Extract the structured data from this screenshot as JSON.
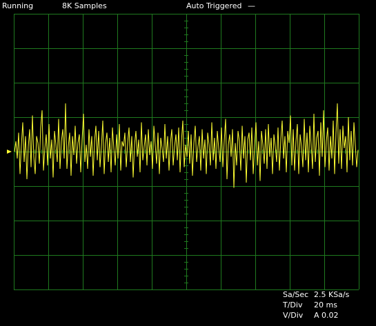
{
  "header": {
    "run_state": "Running",
    "samples": "8K Samples",
    "trigger_status": "Auto Triggered",
    "trigger_indicator": "—"
  },
  "readouts": {
    "sample_rate_label": "Sa/Sec",
    "sample_rate_value": "2.5 KSa/s",
    "time_div_label": "T/Div",
    "time_div_value": "20 ms",
    "volt_div_label": "V/Div",
    "volt_div_value": "A 0.02"
  },
  "colors": {
    "background": "#000000",
    "grid": "#1f7a1f",
    "trace": "#ffff33",
    "text": "#ffffff"
  },
  "icons": {
    "trigger_marker": "trigger-level-arrow-icon"
  },
  "chart_data": {
    "type": "line",
    "title": "",
    "xlabel": "",
    "ylabel": "",
    "grid": true,
    "x_divisions": 10,
    "y_divisions": 8,
    "xlim": [
      0,
      200
    ],
    "ylim": [
      -0.08,
      0.08
    ],
    "x_unit": "ms",
    "y_unit": "V",
    "series": [
      {
        "channel": "A",
        "values": [
          0.0,
          0.006,
          -0.004,
          0.011,
          -0.013,
          0.004,
          0.017,
          -0.006,
          0.009,
          -0.016,
          0.003,
          0.013,
          -0.009,
          0.021,
          -0.003,
          -0.013,
          0.009,
          0.005,
          -0.007,
          0.014,
          0.024,
          -0.011,
          0.002,
          0.01,
          -0.008,
          0.016,
          -0.004,
          0.007,
          -0.015,
          0.012,
          0.004,
          -0.006,
          0.019,
          -0.01,
          0.006,
          0.013,
          -0.004,
          0.028,
          -0.01,
          0.003,
          0.011,
          -0.014,
          0.009,
          -0.002,
          0.015,
          -0.007,
          0.005,
          0.01,
          -0.012,
          0.007,
          0.022,
          -0.006,
          0.004,
          -0.01,
          0.013,
          -0.003,
          0.009,
          -0.014,
          0.006,
          0.015,
          -0.005,
          0.012,
          -0.009,
          0.003,
          0.018,
          -0.013,
          0.005,
          0.011,
          -0.006,
          0.008,
          -0.012,
          0.014,
          0.002,
          -0.008,
          0.01,
          -0.004,
          0.016,
          -0.011,
          0.006,
          0.003,
          0.011,
          -0.009,
          0.005,
          0.014,
          -0.006,
          0.009,
          -0.015,
          0.004,
          0.012,
          -0.003,
          0.007,
          -0.012,
          0.017,
          -0.005,
          0.003,
          0.01,
          -0.008,
          0.013,
          -0.002,
          0.006,
          -0.01,
          0.015,
          0.004,
          -0.007,
          0.011,
          -0.013,
          0.008,
          0.002,
          -0.006,
          0.016,
          -0.004,
          0.009,
          -0.011,
          0.005,
          0.013,
          -0.008,
          0.003,
          0.01,
          -0.005,
          0.014,
          -0.012,
          0.006,
          0.018,
          -0.009,
          0.004,
          -0.003,
          0.012,
          -0.007,
          0.01,
          -0.014,
          0.005,
          0.015,
          -0.006,
          0.003,
          0.009,
          -0.011,
          0.013,
          -0.004,
          0.007,
          -0.013,
          0.011,
          0.004,
          -0.008,
          0.017,
          -0.005,
          0.008,
          -0.01,
          0.012,
          0.002,
          -0.006,
          0.014,
          -0.009,
          0.006,
          0.019,
          -0.016,
          0.004,
          0.01,
          -0.003,
          0.013,
          -0.021,
          0.005,
          -0.008,
          0.012,
          0.006,
          -0.011,
          0.015,
          -0.004,
          0.009,
          -0.018,
          0.007,
          0.011,
          -0.005,
          0.014,
          -0.013,
          0.003,
          0.017,
          -0.008,
          0.006,
          -0.017,
          0.012,
          0.004,
          -0.007,
          0.013,
          -0.01,
          0.016,
          -0.003,
          0.008,
          -0.013,
          0.01,
          0.003,
          -0.006,
          0.014,
          -0.011,
          0.007,
          0.018,
          -0.004,
          0.009,
          -0.012,
          0.012,
          0.005,
          0.021,
          -0.008,
          0.013,
          -0.011,
          0.006,
          0.016,
          -0.013,
          0.01,
          0.003,
          -0.009,
          0.019,
          -0.005,
          0.011,
          -0.012,
          0.015,
          0.004,
          -0.01,
          0.022,
          -0.006,
          0.008,
          0.012,
          -0.014,
          0.017,
          -0.003,
          0.024,
          -0.009,
          0.006,
          0.014,
          -0.011,
          0.009,
          -0.004,
          0.018,
          -0.013,
          0.011,
          0.028,
          -0.007,
          0.013,
          -0.01,
          0.015,
          0.002,
          0.009,
          -0.012,
          0.02,
          -0.005,
          0.012,
          -0.008,
          0.017,
          0.004,
          -0.009,
          0.001
        ]
      }
    ]
  }
}
